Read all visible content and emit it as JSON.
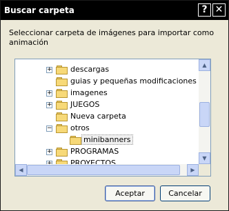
{
  "dialog": {
    "title": "Buscar carpeta",
    "help_glyph": "?",
    "close_glyph": "✕",
    "instruction": "Seleccionar carpeta de imágenes para importar como animación"
  },
  "tree": {
    "items": [
      {
        "label": "descargas",
        "expander": "+",
        "selected": false
      },
      {
        "label": "guias y pequeñas modificaciones phpbb",
        "expander": "",
        "selected": false
      },
      {
        "label": "imagenes",
        "expander": "+",
        "selected": false
      },
      {
        "label": "JUEGOS",
        "expander": "+",
        "selected": false
      },
      {
        "label": "Nueva carpeta",
        "expander": "",
        "selected": false
      },
      {
        "label": "otros",
        "expander": "−",
        "selected": false
      },
      {
        "label": "minibanners",
        "expander": "",
        "selected": true
      },
      {
        "label": "PROGRAMAS",
        "expander": "+",
        "selected": false
      },
      {
        "label": "PROYECTOS",
        "expander": "+",
        "selected": false
      }
    ],
    "scroll_up_glyph": "▲",
    "scroll_down_glyph": "▼",
    "scroll_left_glyph": "◀",
    "scroll_right_glyph": "▶"
  },
  "buttons": {
    "ok_label": "Aceptar",
    "cancel_label": "Cancelar"
  }
}
